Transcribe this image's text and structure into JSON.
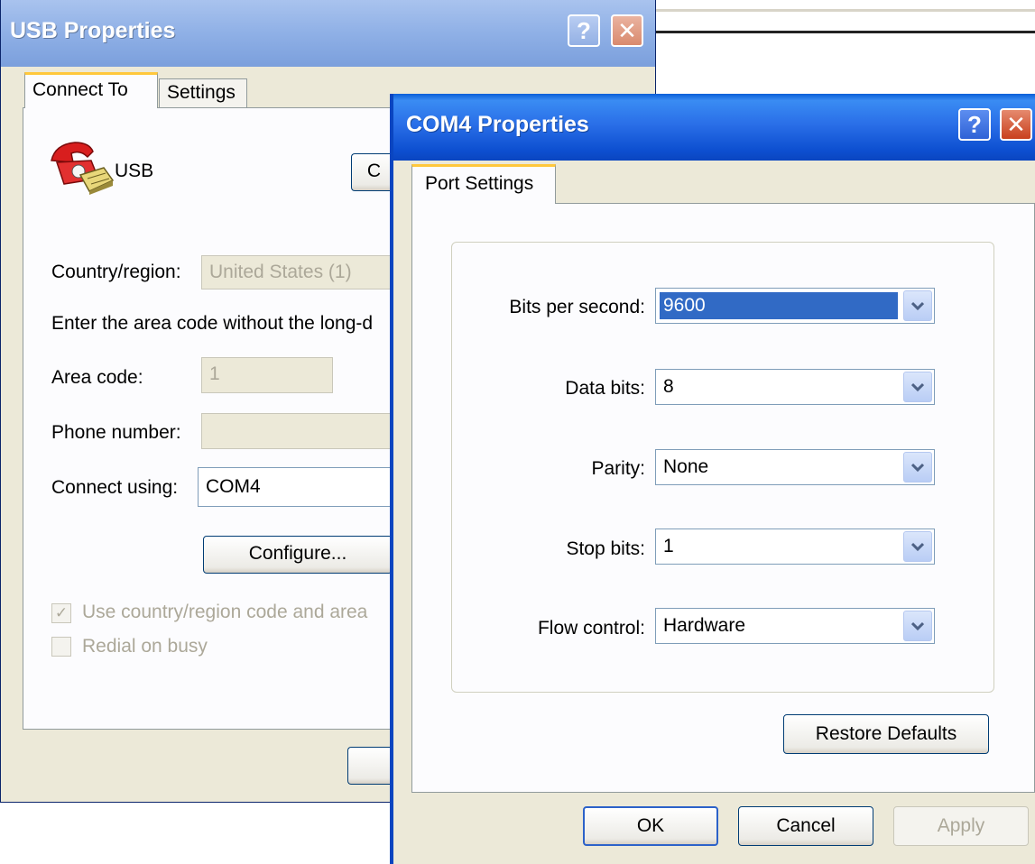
{
  "usb_window": {
    "title": "USB Properties",
    "help_glyph": "?",
    "close_glyph": "✕",
    "tabs": [
      {
        "label": "Connect To",
        "active": true
      },
      {
        "label": "Settings",
        "active": false
      }
    ],
    "connection_name": "USB",
    "partial_button_label": "C",
    "country_label": "Country/region:",
    "country_value": "United States (1)",
    "instruction_text": "Enter the area code without the long-d",
    "area_code_label": "Area code:",
    "area_code_value": "1",
    "phone_label": "Phone number:",
    "phone_value": "",
    "connect_using_label": "Connect using:",
    "connect_using_value": "COM4",
    "configure_button": "Configure...",
    "use_country_checkbox": {
      "label": "Use country/region code and area",
      "checked": true,
      "check_glyph": "✓"
    },
    "redial_checkbox": {
      "label": "Redial on busy",
      "checked": false
    }
  },
  "com_window": {
    "title": "COM4 Properties",
    "help_glyph": "?",
    "close_glyph": "✕",
    "tabs": [
      {
        "label": "Port Settings",
        "active": true
      }
    ],
    "fields": {
      "bits_per_second": {
        "label": "Bits per second:",
        "value": "9600"
      },
      "data_bits": {
        "label": "Data bits:",
        "value": "8"
      },
      "parity": {
        "label": "Parity:",
        "value": "None"
      },
      "stop_bits": {
        "label": "Stop bits:",
        "value": "1"
      },
      "flow_control": {
        "label": "Flow control:",
        "value": "Hardware"
      }
    },
    "restore_defaults_button": "Restore Defaults",
    "ok_button": "OK",
    "cancel_button": "Cancel",
    "apply_button": "Apply"
  },
  "colors": {
    "titlebar_active": "#0a45c0",
    "titlebar_inactive": "#8fb0e6",
    "dialog_bg": "#ece9d8",
    "selection": "#316ac5",
    "tab_highlight": "#ffc83c"
  },
  "icons": [
    "help-icon",
    "close-icon",
    "phone-icon",
    "dropdown-arrow-icon",
    "checkmark-icon"
  ]
}
